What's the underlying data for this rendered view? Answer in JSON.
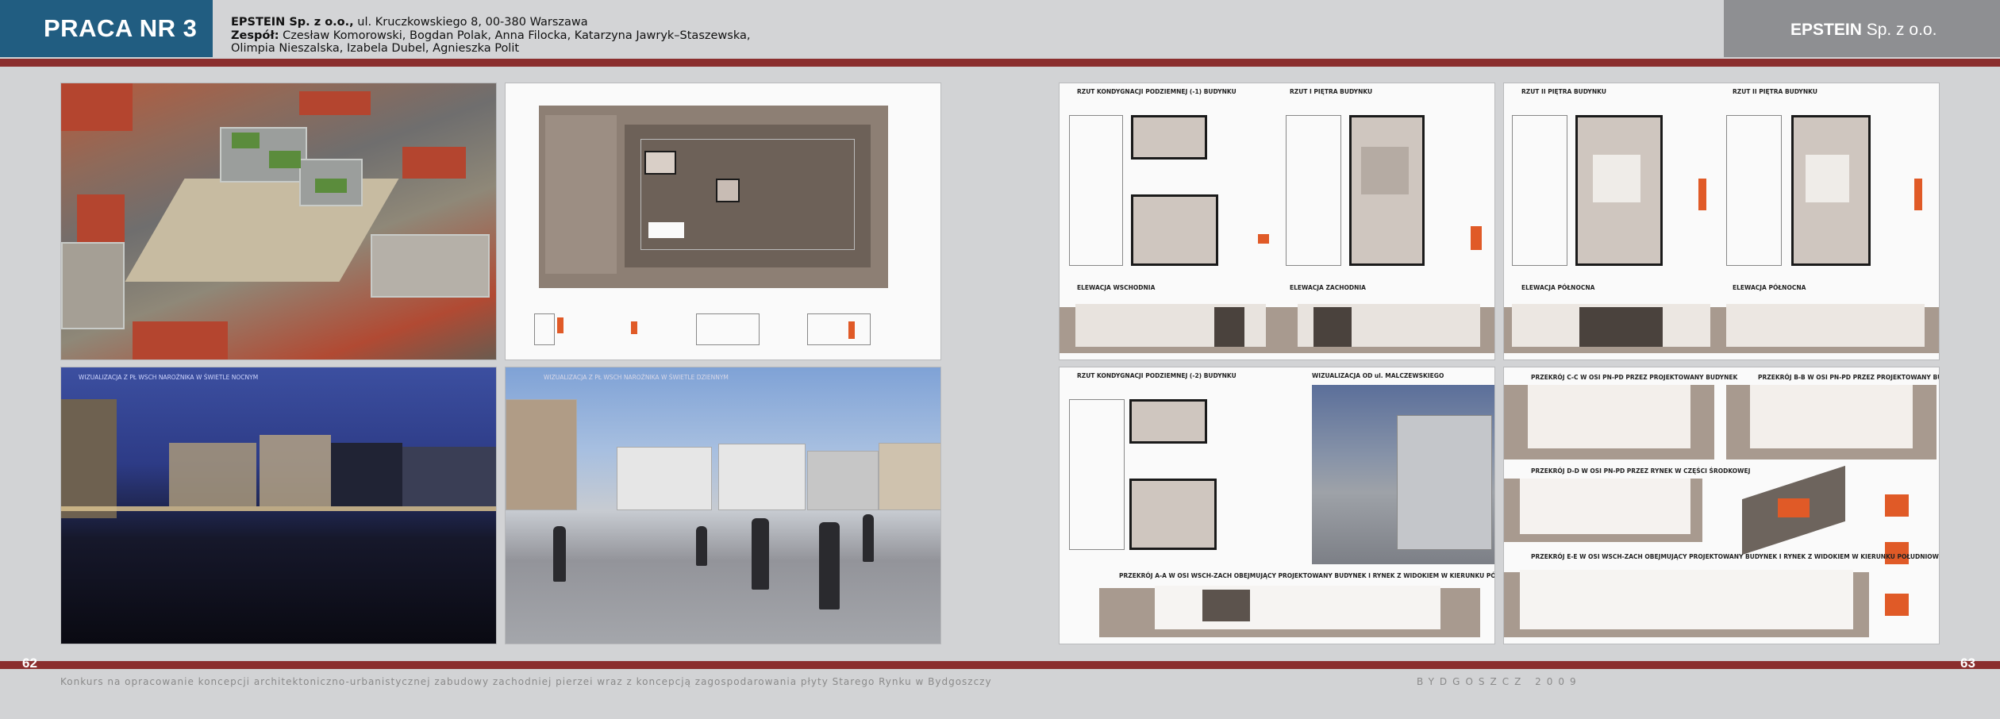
{
  "header": {
    "title": "PRACA NR 3",
    "firm_name": "EPSTEIN Sp. z o.o.,",
    "firm_address": " ul. Kruczkowskiego 8, 00-380 Warszawa",
    "team_label": "Zespół:",
    "team_line1": " Czesław Komorowski, Bogdan Polak, Anna Filocka, Katarzyna Jawryk–Staszewska,",
    "team_line2": "Olimpia Nieszalska, Izabela Dubel, Agnieszka Polit",
    "right_brand_bold": "EPSTEIN",
    "right_brand_rest": " Sp. z o.o."
  },
  "footer": {
    "page_left": "62",
    "page_right": "63",
    "text": "Konkurs na opracowanie koncepcji architektoniczno-urbanistycznej zabudowy zachodniej pierzei wraz z koncepcją zagospodarowania płyty Starego Rynku w Bydgoszczy",
    "city_year": "BYDGOSZCZ   2009"
  },
  "panels": {
    "night_caption": "WIZUALIZACJA Z PŁ WSCH NAROŻNIKA W ŚWIETLE NOCNYM",
    "day_caption": "WIZUALIZACJA Z PŁ WSCH NAROŻNIKA W ŚWIETLE DZIENNYM",
    "p3_tl": "RZUT KONDYGNACJI PODZIEMNEJ (-1) BUDYNKU",
    "p3_tr": "RZUT I PIĘTRA BUDYNKU",
    "p3_bl": "ELEWACJA WSCHODNIA",
    "p3_br": "ELEWACJA ZACHODNIA",
    "p4_tl": "RZUT II PIĘTRA BUDYNKU",
    "p4_tr": "RZUT II PIĘTRA BUDYNKU",
    "p4_bl": "ELEWACJA PÓŁNOCNA",
    "p4_br": "ELEWACJA PÓŁNOCNA",
    "p5_tl": "RZUT KONDYGNACJI PODZIEMNEJ (-2) BUDYNKU",
    "p5_tr": "WIZUALIZACJA OD ul. MALCZEWSKIEGO",
    "p5_bottom": "PRZEKRÓJ A-A W OSI WSCH-ZACH OBEJMUJĄCY PROJEKTOWANY BUDYNEK I RYNEK Z WIDOKIEM W KIERUNKU PÓŁNOCNYM",
    "p6_tl": "PRZEKRÓJ C-C W OSI PN-PD PRZEZ PROJEKTOWANY BUDYNEK",
    "p6_tr": "PRZEKRÓJ B-B W OSI PN-PD PRZEZ PROJEKTOWANY BUDYNEK",
    "p6_mid": "PRZEKRÓJ D-D W OSI PN-PD PRZEZ RYNEK W CZĘŚCI ŚRODKOWEJ",
    "p6_bottom": "PRZEKRÓJ E-E W OSI WSCH-ZACH OBEJMUJĄCY PROJEKTOWANY BUDYNEK I RYNEK Z WIDOKIEM W KIERUNKU POŁUDNIOWYM"
  },
  "colors": {
    "header_blue": "#215d81",
    "rule_red": "#8b2e2e",
    "header_gray": "#8e8f92"
  }
}
